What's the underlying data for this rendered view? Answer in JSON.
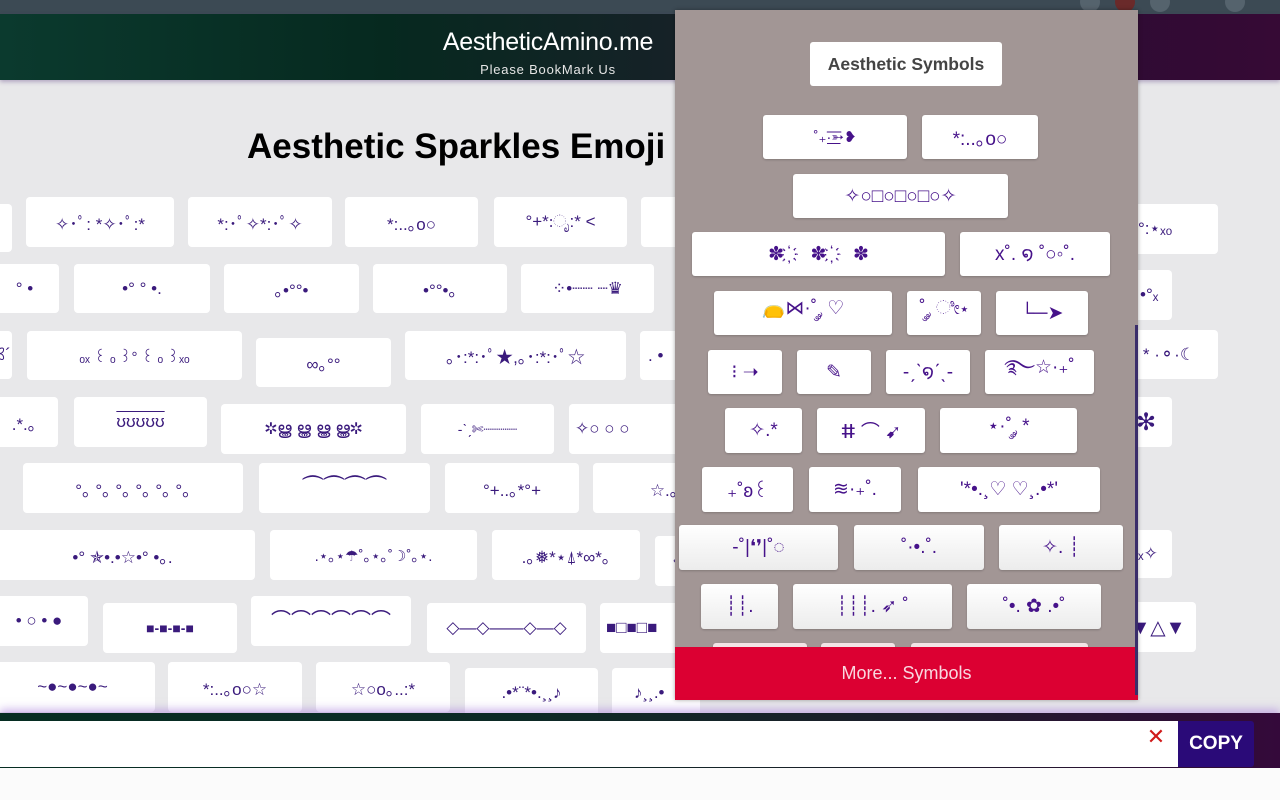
{
  "header": {
    "site_title": "AestheticAmino.me",
    "subtitle": "Please BookMark Us"
  },
  "page_title": "Aesthetic Sparkles Emoji",
  "symbols": [
    {
      "row": 1,
      "text": ""
    },
    {
      "row": 1,
      "text": "✧･ﾟ: *✧･ﾟ:*"
    },
    {
      "row": 1,
      "text": "*:･ﾟ✧*:･ﾟ✧"
    },
    {
      "row": 1,
      "text": "*:..｡o○"
    },
    {
      "row": 1,
      "text": "°+*:ೃ:* <"
    },
    {
      "row": 1,
      "text": ""
    },
    {
      "row": 1,
      "text": "°:⋆ₓₒ"
    },
    {
      "row": 2,
      "text": "°  •"
    },
    {
      "row": 2,
      "text": "•° °  •."
    },
    {
      "row": 2,
      "text": "｡•°°•"
    },
    {
      "row": 2,
      "text": "•°°•｡"
    },
    {
      "row": 2,
      "text": "⁘•┈┈  ┈♛"
    },
    {
      "row": 2,
      "text": "•°ₓ"
    },
    {
      "row": 3,
      "text": "ꕤ´"
    },
    {
      "row": 3,
      "text": "ₒₓ ꒰ ₒ ꒱° ꒰ ₒ ꒱ₓₒ"
    },
    {
      "row": 3,
      "text": "∞｡°°"
    },
    {
      "row": 3,
      "text": "｡･:*:･ﾟ★,｡･:*:･ﾟ☆"
    },
    {
      "row": 3,
      "text": ". •"
    },
    {
      "row": 3,
      "text": "*  ·⚬·☾"
    },
    {
      "row": 4,
      "text": ".*.｡"
    },
    {
      "row": 4,
      "text": "ʊʊʊʊʊ"
    },
    {
      "row": 4,
      "text": "✲ൠ ൠ ൠ ൠ✲"
    },
    {
      "row": 4,
      "text": "-ˋˏ✄┈┈┈┈"
    },
    {
      "row": 4,
      "text": "✧○ ○ ○"
    },
    {
      "row": 4,
      "text": "✻"
    },
    {
      "row": 5,
      "text": "°｡ °｡ °｡ °｡ °｡ °｡"
    },
    {
      "row": 5,
      "text": "⏜⏜⏜⏜"
    },
    {
      "row": 5,
      "text": "°+..｡*°+"
    },
    {
      "row": 5,
      "text": "☆.｡."
    },
    {
      "row": 6,
      "text": "•°  ✯•.•☆•°  •｡."
    },
    {
      "row": 6,
      "text": ".⋆｡⋆☂˚｡⋆｡˚☽˚｡⋆."
    },
    {
      "row": 6,
      "text": ".｡❅*⋆⍋*∞*｡"
    },
    {
      "row": 6,
      "text": "‹"
    },
    {
      "row": 6,
      "text": "ₓ✧"
    },
    {
      "row": 7,
      "text": "• ○ • ●"
    },
    {
      "row": 7,
      "text": "■-■-■-■"
    },
    {
      "row": 7,
      "text": "⌒⌒⌒⌒⌒⌒"
    },
    {
      "row": 7,
      "text": "◇—◇——◇—◇"
    },
    {
      "row": 7,
      "text": "■□■□■"
    },
    {
      "row": 7,
      "text": "▼△▼"
    },
    {
      "row": 8,
      "text": "~●~●~●~"
    },
    {
      "row": 8,
      "text": "*:..｡o○☆"
    },
    {
      "row": 8,
      "text": "☆○o｡..:*"
    },
    {
      "row": 8,
      "text": ".•*¨*•.¸¸♪"
    },
    {
      "row": 8,
      "text": "♪¸¸.•"
    }
  ],
  "popup": {
    "title": "Aesthetic Symbols",
    "symbols": [
      "˚₊·͟͟͟͟͟͟͞͞͞͞͞͞➳❥",
      "*:..｡o○",
      "✧○□○□○□○✧",
      "✽  ҉  ✽  ҉  ✽",
      "x˚. ໑ ˚○◦˚.",
      "👝⋈·˚ ༘ ♡",
      "˚ ༘ ೀ⋆",
      "└─➤",
      "⁝ ➝",
      "✎",
      "-ˏˋ໑ˊˎ-",
      "࿐☆·₊˚",
      "✧.*",
      "ⵌ ⌒ ➹",
      "⋆·˚ ༘ *",
      "₊˚ʚ꒰",
      "≋·₊˚.",
      "'*•.¸♡ ♡¸.•*'",
      "-˚|❛❜|˚◌",
      "˚·•.˚.",
      "✧. ┊",
      "┊┊.",
      "┊┊┊. ➶ ˚",
      "˚•. ✿ .•˚"
    ],
    "more_label": "More... Symbols"
  },
  "copy_bar": {
    "input_value": "",
    "clear_label": "✕",
    "copy_label": "COPY"
  },
  "colors": {
    "accent_purple": "#2a0a78",
    "more_button_red": "#dc0032",
    "symbol_color": "#3a1a7c"
  }
}
